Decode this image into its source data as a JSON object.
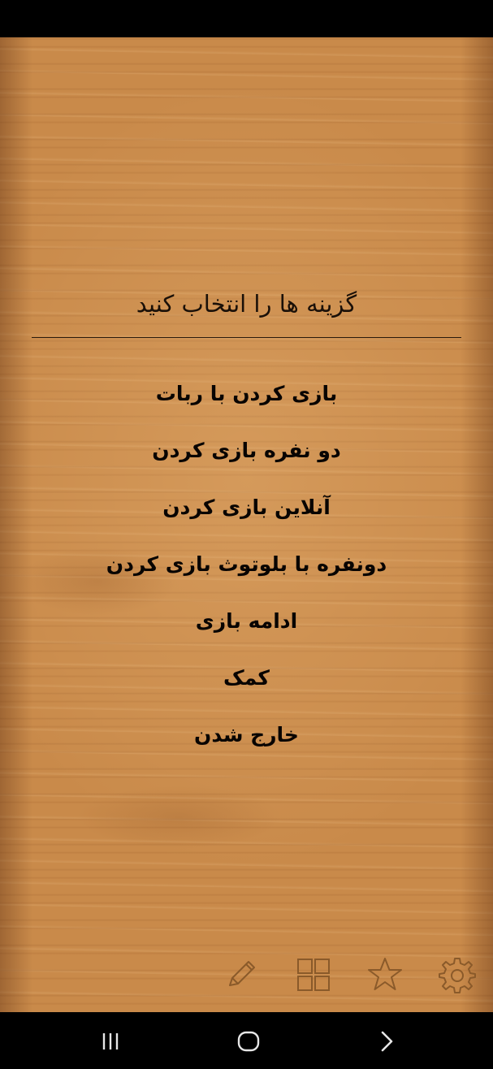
{
  "screen": {
    "title": "گزینه ها را انتخاب کنید",
    "menu": [
      {
        "label": "بازی کردن با ربات"
      },
      {
        "label": "دو نفره بازی کردن"
      },
      {
        "label": "آنلاین بازی کردن"
      },
      {
        "label": "دونفره با بلوتوث بازی کردن"
      },
      {
        "label": "ادامه بازی"
      },
      {
        "label": "کمک"
      },
      {
        "label": "خارج شدن"
      }
    ]
  },
  "toolbar": {
    "icons": [
      "pencil-icon",
      "grid-icon",
      "star-icon",
      "gear-icon"
    ],
    "icon_color": "#8a5a2a"
  },
  "navbar": {
    "icons": [
      "recent-apps-icon",
      "home-icon",
      "back-icon"
    ],
    "icon_color": "#e6e6e6"
  },
  "colors": {
    "wood_base": "#c98a4a",
    "text": "#080402"
  }
}
